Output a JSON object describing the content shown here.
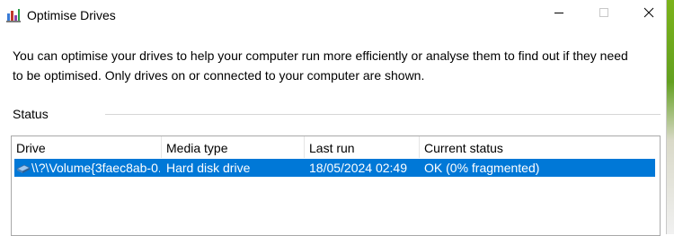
{
  "window": {
    "title": "Optimise Drives",
    "icon": "optimise-drives-icon",
    "controls": {
      "minimize": "minimize-icon",
      "maximize": "maximize-icon",
      "close": "close-icon"
    }
  },
  "description": "You can optimise your drives to help your computer run more efficiently or analyse them to find out if they need to be optimised. Only drives on or connected to your computer are shown.",
  "status": {
    "label": "Status",
    "columns": [
      "Drive",
      "Media type",
      "Last run",
      "Current status"
    ],
    "rows": [
      {
        "icon": "hard-drive-icon",
        "drive": "\\\\?\\Volume{3faec8ab-0...",
        "media_type": "Hard disk drive",
        "last_run": "18/05/2024 02:49",
        "current_status": "OK (0% fragmented)",
        "selected": true
      }
    ]
  },
  "colors": {
    "selection": "#0078d7",
    "selection_text": "#ffffff",
    "border": "#a9a9a9"
  }
}
